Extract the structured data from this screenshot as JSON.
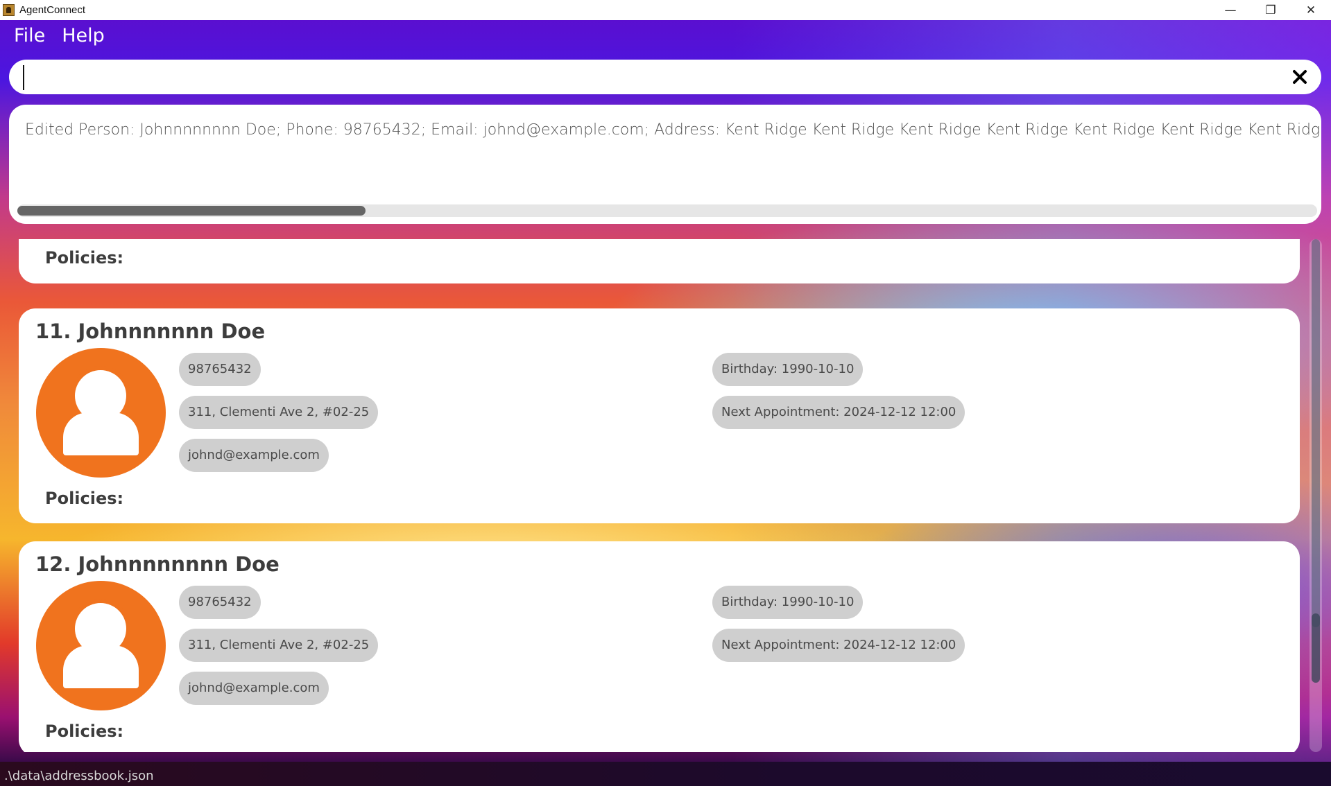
{
  "window": {
    "title": "AgentConnect",
    "controls": {
      "minimize": "—",
      "restore": "❐",
      "close": "✕"
    }
  },
  "menu": {
    "file": "File",
    "help": "Help"
  },
  "command": {
    "value": "",
    "placeholder": ""
  },
  "result": {
    "text": "Edited Person: Johnnnnnnnn Doe; Phone: 98765432; Email: johnd@example.com; Address: Kent Ridge Kent Ridge Kent Ridge Kent Ridge Kent Ridge Kent Ridge Kent Ridge Kent Ridge Kent R"
  },
  "list": {
    "prev_card": {
      "policies_label": "Policies:"
    },
    "cards": [
      {
        "title": "11. Johnnnnnnn Doe",
        "phone": "98765432",
        "address": "311, Clementi Ave 2, #02-25",
        "email": "johnd@example.com",
        "birthday": "Birthday: 1990-10-10",
        "appointment": "Next Appointment: 2024-12-12 12:00",
        "policies_label": "Policies:"
      },
      {
        "title": "12. Johnnnnnnnn Doe",
        "phone": "98765432",
        "address": "311, Clementi Ave 2, #02-25",
        "email": "johnd@example.com",
        "birthday": "Birthday: 1990-10-10",
        "appointment": "Next Appointment: 2024-12-12 12:00",
        "policies_label": "Policies:"
      }
    ]
  },
  "status": {
    "path": ".\\data\\addressbook.json"
  },
  "colors": {
    "avatar": "#f0731e",
    "tag": "#cfcfcf",
    "card": "#ffffff"
  }
}
